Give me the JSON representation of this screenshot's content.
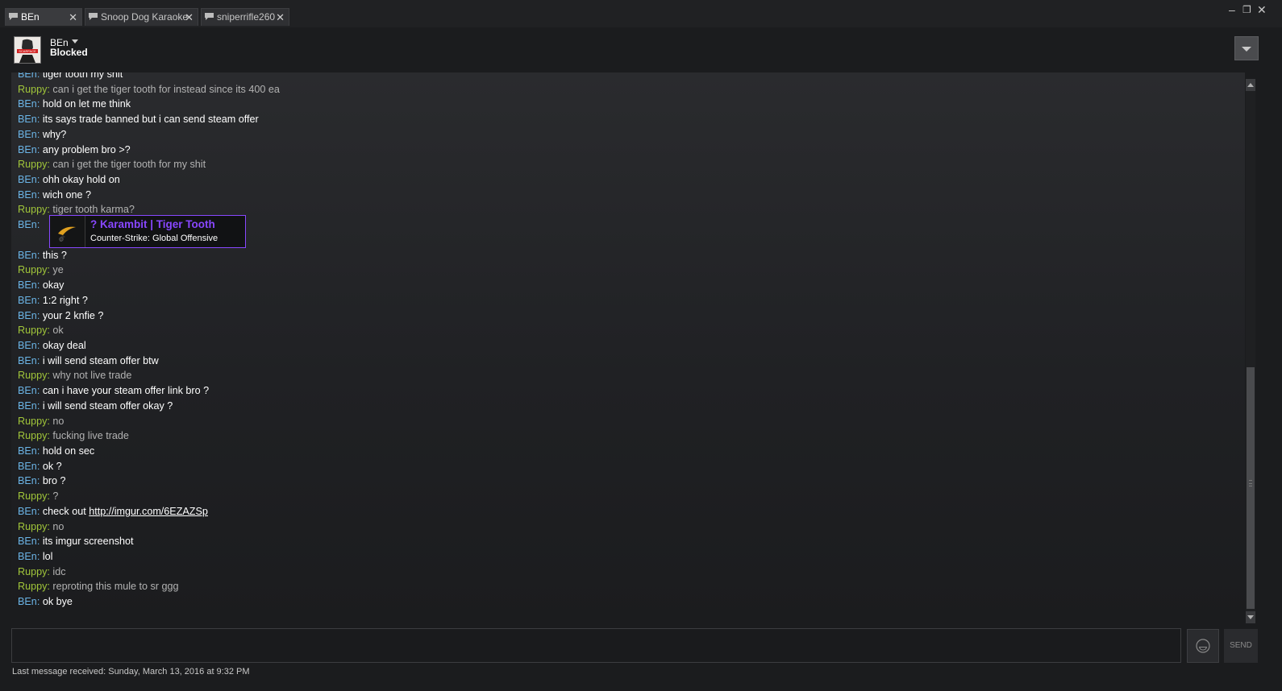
{
  "tabs": [
    {
      "label": "BEn",
      "active": true
    },
    {
      "label": "Snoop Dog Karaoke",
      "active": false
    },
    {
      "label": "sniperrifle260",
      "active": false
    }
  ],
  "window_controls": {
    "minimize": "–",
    "restore": "❐",
    "close": "✕"
  },
  "header": {
    "friend_name": "BEn",
    "status": "Blocked",
    "avatar_text": "SCARFACE"
  },
  "colors": {
    "ben_name": "#6bb4e6",
    "ruppy_name": "#a1c63a",
    "item_purple": "#8847ff"
  },
  "messages": [
    {
      "sender": "BEn",
      "text": "tiger tooth my shit"
    },
    {
      "sender": "Ruppy",
      "text": "can i get the tiger tooth for instead since its 400 ea"
    },
    {
      "sender": "BEn",
      "text": "hold on let me think"
    },
    {
      "sender": "BEn",
      "text": "its says trade banned but i can send steam offer"
    },
    {
      "sender": "BEn",
      "text": "why?"
    },
    {
      "sender": "BEn",
      "text": "any problem bro >?"
    },
    {
      "sender": "Ruppy",
      "text": "can i get the tiger tooth for my shit"
    },
    {
      "sender": "BEn",
      "text": "ohh okay hold on"
    },
    {
      "sender": "BEn",
      "text": "wich one ?"
    },
    {
      "sender": "Ruppy",
      "text": "tiger tooth karma?"
    },
    {
      "sender": "BEn",
      "text": "",
      "item": {
        "name": "? Karambit | Tiger Tooth",
        "game": "Counter-Strike: Global Offensive"
      }
    },
    {
      "sender": "BEn",
      "text": "this ?"
    },
    {
      "sender": "Ruppy",
      "text": "ye"
    },
    {
      "sender": "BEn",
      "text": "okay"
    },
    {
      "sender": "BEn",
      "text": "1:2 right ?"
    },
    {
      "sender": "BEn",
      "text": "your 2 knfie ?"
    },
    {
      "sender": "Ruppy",
      "text": "ok"
    },
    {
      "sender": "BEn",
      "text": "okay deal"
    },
    {
      "sender": "BEn",
      "text": "i will send steam offer btw"
    },
    {
      "sender": "Ruppy",
      "text": "why not live trade"
    },
    {
      "sender": "BEn",
      "text": "can i have your steam offer link bro ?"
    },
    {
      "sender": "BEn",
      "text": "i will send steam offer okay ?"
    },
    {
      "sender": "Ruppy",
      "text": "no"
    },
    {
      "sender": "Ruppy",
      "text": "fucking live trade"
    },
    {
      "sender": "BEn",
      "text": "hold on sec"
    },
    {
      "sender": "BEn",
      "text": "ok ?"
    },
    {
      "sender": "BEn",
      "text": "bro ?"
    },
    {
      "sender": "Ruppy",
      "text": "?"
    },
    {
      "sender": "BEn",
      "text": "check out ",
      "link": "http://imgur.com/6EZAZSp"
    },
    {
      "sender": "Ruppy",
      "text": "no"
    },
    {
      "sender": "BEn",
      "text": "its imgur screenshot"
    },
    {
      "sender": "BEn",
      "text": "lol"
    },
    {
      "sender": "Ruppy",
      "text": "idc"
    },
    {
      "sender": "Ruppy",
      "text": "reproting this mule to sr ggg"
    },
    {
      "sender": "BEn",
      "text": "ok bye"
    }
  ],
  "input": {
    "value": "",
    "placeholder": ""
  },
  "send_label": "SEND",
  "last_received": "Last message received: Sunday, March 13, 2016 at 9:32 PM"
}
